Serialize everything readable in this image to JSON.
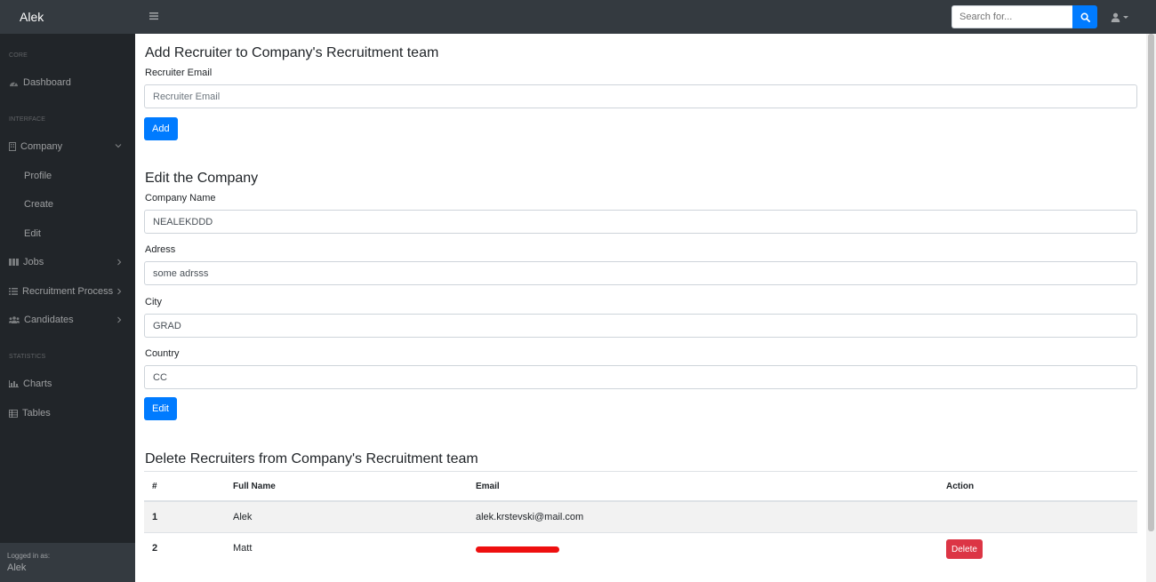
{
  "brand": "Alek",
  "search": {
    "placeholder": "Search for..."
  },
  "colors": {
    "primary": "#007bff",
    "danger": "#dc3545",
    "sidebar_bg": "#212529",
    "topbar_bg": "#343a40"
  },
  "sidebar": {
    "core_heading": "CORE",
    "dashboard": "Dashboard",
    "interface_heading": "INTERFACE",
    "company": "Company",
    "company_sub": {
      "profile": "Profile",
      "create": "Create",
      "edit": "Edit"
    },
    "jobs": "Jobs",
    "recruitment": "Recruitment Process",
    "candidates": "Candidates",
    "statistics_heading": "STATISTICS",
    "charts": "Charts",
    "tables": "Tables",
    "footer_label": "Logged in as:",
    "footer_user": "Alek"
  },
  "add_section": {
    "title": "Add Recruiter to Company's Recruitment team",
    "email_label": "Recruiter Email",
    "email_placeholder": "Recruiter Email",
    "add_button": "Add"
  },
  "edit_section": {
    "title": "Edit the Company",
    "name_label": "Company Name",
    "name_value": "NEALEKDDD",
    "address_label": "Adress",
    "address_value": "some adrsss",
    "city_label": "City",
    "city_value": "GRAD",
    "country_label": "Country",
    "country_value": "CC",
    "edit_button": "Edit"
  },
  "delete_section": {
    "title": "Delete Recruiters from Company's Recruitment team",
    "columns": [
      "#",
      "Full Name",
      "Email",
      "Action"
    ],
    "rows": [
      {
        "num": "1",
        "name": "Alek",
        "email": "alek.krstevski@mail.com",
        "action": ""
      },
      {
        "num": "2",
        "name": "Matt",
        "email": "",
        "action": "Delete"
      }
    ]
  }
}
